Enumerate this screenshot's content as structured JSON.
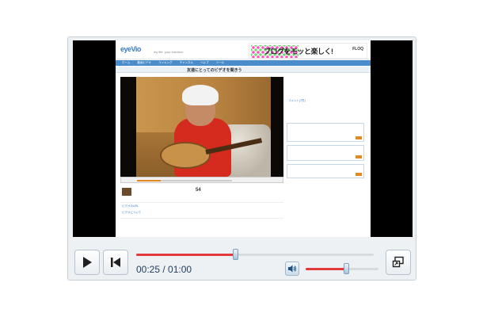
{
  "player": {
    "time_display": "00:25 / 01:00",
    "current_time": "00:25",
    "duration": "01:00",
    "progress_fraction": 0.4167,
    "volume_fraction": 0.55,
    "icons": {
      "play": "play-icon",
      "previous": "skip-back-icon",
      "volume": "speaker-icon",
      "fullscreen": "fullscreen-icon"
    },
    "accent_color": "#e23b3b"
  },
  "video_frame": {
    "site_logo": "eyeVio",
    "site_tagline": "my life. your emotion.",
    "banner_text": "ブログをモッと楽しく!",
    "banner_brand": "FLOQ",
    "nav_items": [
      "ホーム",
      "動画ビデオ",
      "ランキング",
      "チャンネル",
      "ヘルプ",
      "ツール"
    ],
    "subheader_title": "友達にとってのビデオを聞きう",
    "view_count": "54",
    "meta_line_1": "ビデオのURL",
    "meta_line_2": "ビデオについて",
    "comment_header": "コメント(7件)"
  }
}
